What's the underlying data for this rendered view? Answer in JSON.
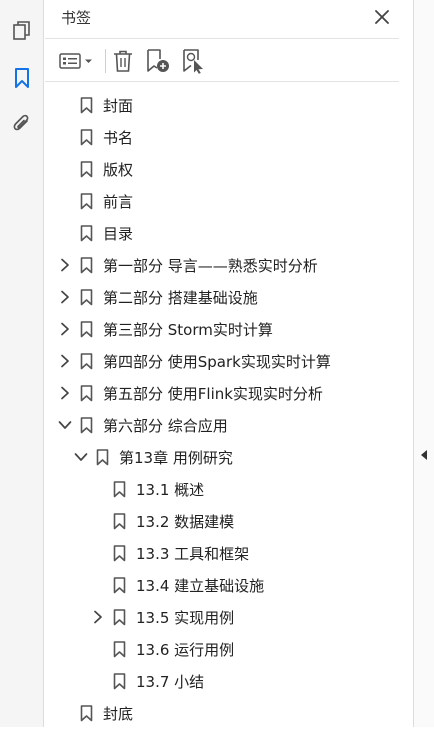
{
  "panel": {
    "title": "书签"
  },
  "rail": {
    "icons": [
      "page-thumbnails-icon",
      "bookmarks-icon",
      "attachments-icon"
    ],
    "active_color": "#1473e6"
  },
  "toolbar": {
    "icons": [
      "options-menu-icon",
      "delete-bookmark-icon",
      "new-bookmark-icon",
      "bookmark-from-selection-icon"
    ]
  },
  "bookmarks": [
    {
      "label": "封面",
      "level": 0,
      "chevron": "none"
    },
    {
      "label": "书名",
      "level": 0,
      "chevron": "none"
    },
    {
      "label": "版权",
      "level": 0,
      "chevron": "none"
    },
    {
      "label": "前言",
      "level": 0,
      "chevron": "none"
    },
    {
      "label": "目录",
      "level": 0,
      "chevron": "none"
    },
    {
      "label": "第一部分  导言——熟悉实时分析",
      "level": 0,
      "chevron": "collapsed"
    },
    {
      "label": "第二部分  搭建基础设施",
      "level": 0,
      "chevron": "collapsed"
    },
    {
      "label": "第三部分  Storm实时计算",
      "level": 0,
      "chevron": "collapsed"
    },
    {
      "label": "第四部分  使用Spark实现实时计算",
      "level": 0,
      "chevron": "collapsed"
    },
    {
      "label": "第五部分  使用Flink实现实时分析",
      "level": 0,
      "chevron": "collapsed"
    },
    {
      "label": "第六部分  综合应用",
      "level": 0,
      "chevron": "expanded"
    },
    {
      "label": "第13章  用例研究",
      "level": 1,
      "chevron": "expanded"
    },
    {
      "label": "13.1  概述",
      "level": 2,
      "chevron": "none"
    },
    {
      "label": "13.2  数据建模",
      "level": 2,
      "chevron": "none"
    },
    {
      "label": "13.3  工具和框架",
      "level": 2,
      "chevron": "none"
    },
    {
      "label": "13.4  建立基础设施",
      "level": 2,
      "chevron": "none"
    },
    {
      "label": "13.5  实现用例",
      "level": 2,
      "chevron": "collapsed"
    },
    {
      "label": "13.6  运行用例",
      "level": 2,
      "chevron": "none"
    },
    {
      "label": "13.7  小结",
      "level": 2,
      "chevron": "none"
    },
    {
      "label": "封底",
      "level": 0,
      "chevron": "none"
    }
  ]
}
